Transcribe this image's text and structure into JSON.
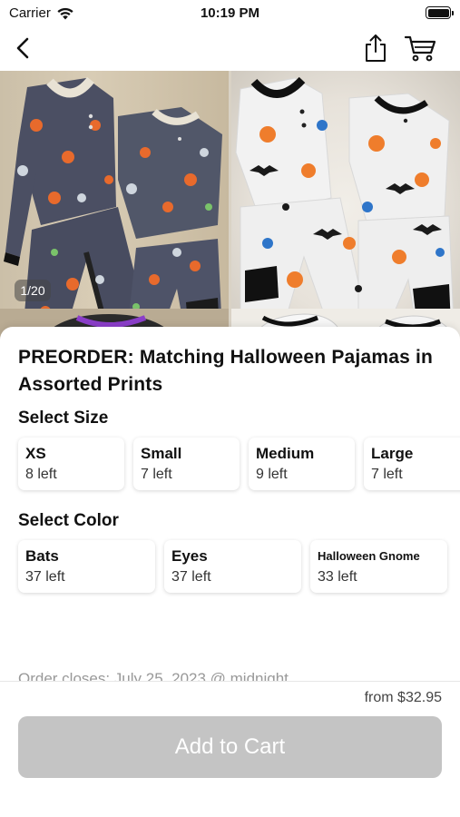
{
  "status_bar": {
    "carrier": "Carrier",
    "time": "10:19 PM"
  },
  "nav": {
    "back_icon": "chevron-left-icon",
    "share_icon": "share-icon",
    "cart_icon": "cart-icon"
  },
  "gallery": {
    "counter": "1/20"
  },
  "product": {
    "title": "PREORDER: Matching Halloween Pajamas in Assorted Prints"
  },
  "size_section": {
    "label": "Select Size",
    "options": [
      {
        "name": "XS",
        "stock": "8 left"
      },
      {
        "name": "Small",
        "stock": "7 left"
      },
      {
        "name": "Medium",
        "stock": "9 left"
      },
      {
        "name": "Large",
        "stock": "7 left"
      }
    ]
  },
  "color_section": {
    "label": "Select Color",
    "options": [
      {
        "name": "Bats",
        "stock": "37 left"
      },
      {
        "name": "Eyes",
        "stock": "37 left"
      },
      {
        "name": "Halloween Gnome",
        "stock": "33 left"
      }
    ]
  },
  "order_closes": "Order closes: July 25, 2023 @ midnight",
  "footer": {
    "price": "from $32.95",
    "add_to_cart_label": "Add to Cart"
  },
  "colors": {
    "button_disabled": "#c4c4c4",
    "text_primary": "#111111",
    "text_muted": "#999999"
  }
}
